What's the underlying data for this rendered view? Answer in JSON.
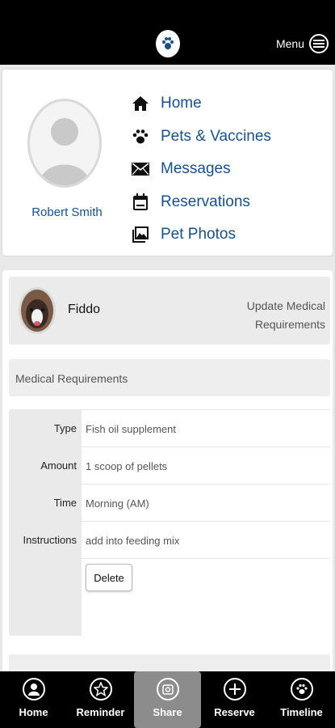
{
  "header": {
    "menu_label": "Menu"
  },
  "profile": {
    "name": "Robert Smith",
    "nav": [
      {
        "label": "Home",
        "icon": "home-icon"
      },
      {
        "label": "Pets & Vaccines",
        "icon": "paw-icon"
      },
      {
        "label": "Messages",
        "icon": "mail-icon"
      },
      {
        "label": "Reservations",
        "icon": "calendar-icon"
      },
      {
        "label": "Pet Photos",
        "icon": "photos-icon"
      }
    ]
  },
  "pet": {
    "name": "Fiddo",
    "update_link": "Update Medical Requirements"
  },
  "section": {
    "title": "Medical Requirements"
  },
  "details": {
    "type_label": "Type",
    "type_value": "Fish oil supplement",
    "amount_label": "Amount",
    "amount_value": "1 scoop of pellets",
    "time_label": "Time",
    "time_value": "Morning (AM)",
    "instructions_label": "Instructions",
    "instructions_value": "add into feeding mix",
    "delete_label": "Delete"
  },
  "tabs": [
    {
      "label": "Home",
      "icon": "user-circle-icon"
    },
    {
      "label": "Reminder",
      "icon": "star-icon"
    },
    {
      "label": "Share",
      "icon": "share-icon"
    },
    {
      "label": "Reserve",
      "icon": "plus-circle-icon"
    },
    {
      "label": "Timeline",
      "icon": "paw-circle-icon"
    }
  ],
  "colors": {
    "link": "#1b4f86",
    "bar": "#000000",
    "active_tab": "#8c8c8c"
  }
}
